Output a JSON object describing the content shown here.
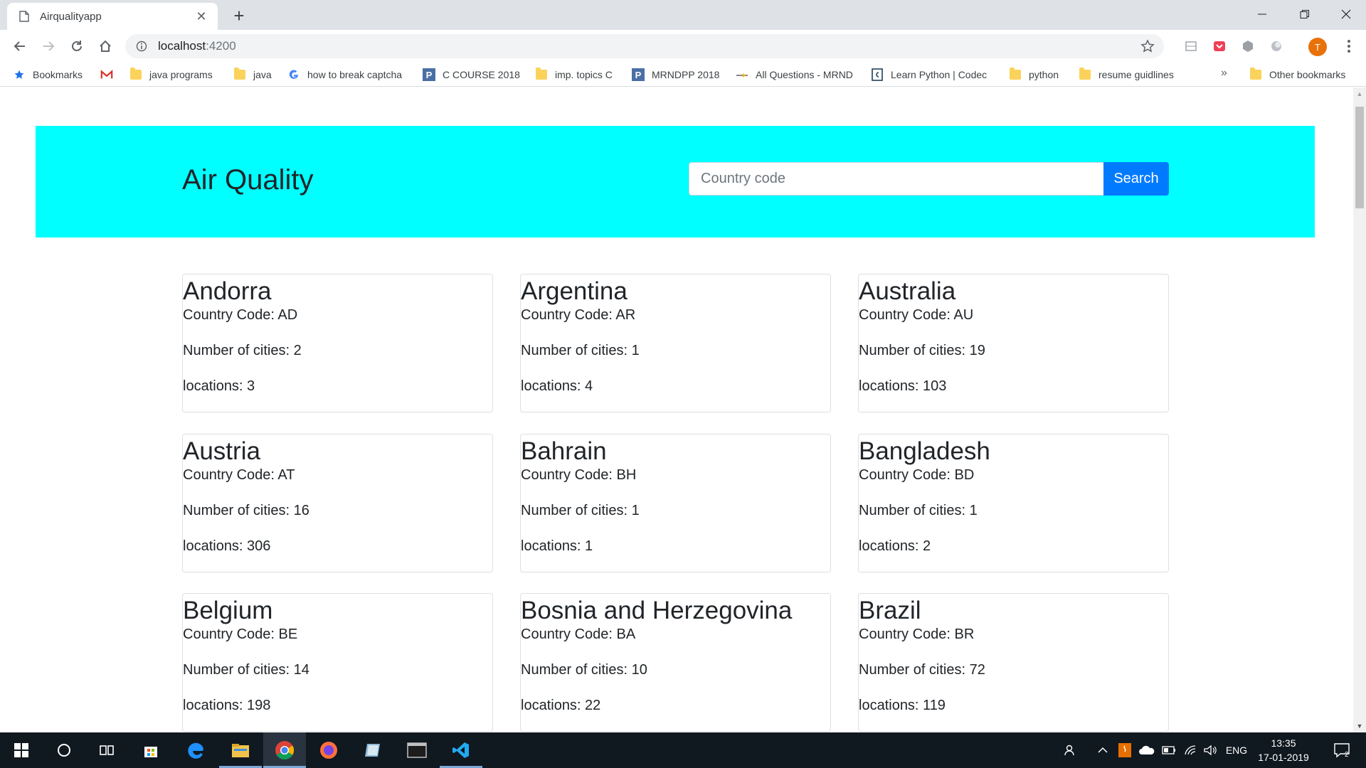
{
  "browser": {
    "tab_title": "Airqualityapp",
    "tab_close": "✕",
    "new_tab": "+",
    "url_host": "localhost",
    "url_port": ":4200",
    "profile_initial": "T",
    "bookmarks": [
      {
        "label": "Bookmarks",
        "icon": "star-icon"
      },
      {
        "label": "",
        "icon": "gmail-icon"
      },
      {
        "label": "java programs",
        "icon": "folder-icon"
      },
      {
        "label": "java",
        "icon": "folder-icon"
      },
      {
        "label": "how to break captcha",
        "icon": "google-icon"
      },
      {
        "label": "C COURSE 2018",
        "icon": "p-icon"
      },
      {
        "label": "imp. topics C",
        "icon": "folder-icon"
      },
      {
        "label": "MRNDPP 2018",
        "icon": "p-icon"
      },
      {
        "label": "All Questions - MRND",
        "icon": "site-icon"
      },
      {
        "label": "Learn Python | Codec",
        "icon": "codecademy-icon"
      },
      {
        "label": "python",
        "icon": "folder-icon"
      },
      {
        "label": "resume guidlines",
        "icon": "folder-icon"
      }
    ],
    "bookmarks_more": "»",
    "other_bookmarks": "Other bookmarks"
  },
  "page": {
    "title": "Air Quality",
    "search_placeholder": "Country code",
    "search_button": "Search",
    "countries": [
      {
        "name": "Andorra",
        "code_line": "Country Code: AD",
        "cities_line": "Number of cities: 2",
        "locations_line": "locations: 3"
      },
      {
        "name": "Argentina",
        "code_line": "Country Code: AR",
        "cities_line": "Number of cities: 1",
        "locations_line": "locations: 4"
      },
      {
        "name": "Australia",
        "code_line": "Country Code: AU",
        "cities_line": "Number of cities: 19",
        "locations_line": "locations: 103"
      },
      {
        "name": "Austria",
        "code_line": "Country Code: AT",
        "cities_line": "Number of cities: 16",
        "locations_line": "locations: 306"
      },
      {
        "name": "Bahrain",
        "code_line": "Country Code: BH",
        "cities_line": "Number of cities: 1",
        "locations_line": "locations: 1"
      },
      {
        "name": "Bangladesh",
        "code_line": "Country Code: BD",
        "cities_line": "Number of cities: 1",
        "locations_line": "locations: 2"
      },
      {
        "name": "Belgium",
        "code_line": "Country Code: BE",
        "cities_line": "Number of cities: 14",
        "locations_line": "locations: 198"
      },
      {
        "name": "Bosnia and Herzegovina",
        "code_line": "Country Code: BA",
        "cities_line": "Number of cities: 10",
        "locations_line": "locations: 22"
      },
      {
        "name": "Brazil",
        "code_line": "Country Code: BR",
        "cities_line": "Number of cities: 72",
        "locations_line": "locations: 119"
      }
    ]
  },
  "taskbar": {
    "language": "ENG",
    "time": "13:35",
    "date": "17-01-2019",
    "notification_count": "2"
  },
  "colors": {
    "jumbotron": "#00ffff",
    "search_button": "#007bff",
    "profile": "#e8710a"
  }
}
